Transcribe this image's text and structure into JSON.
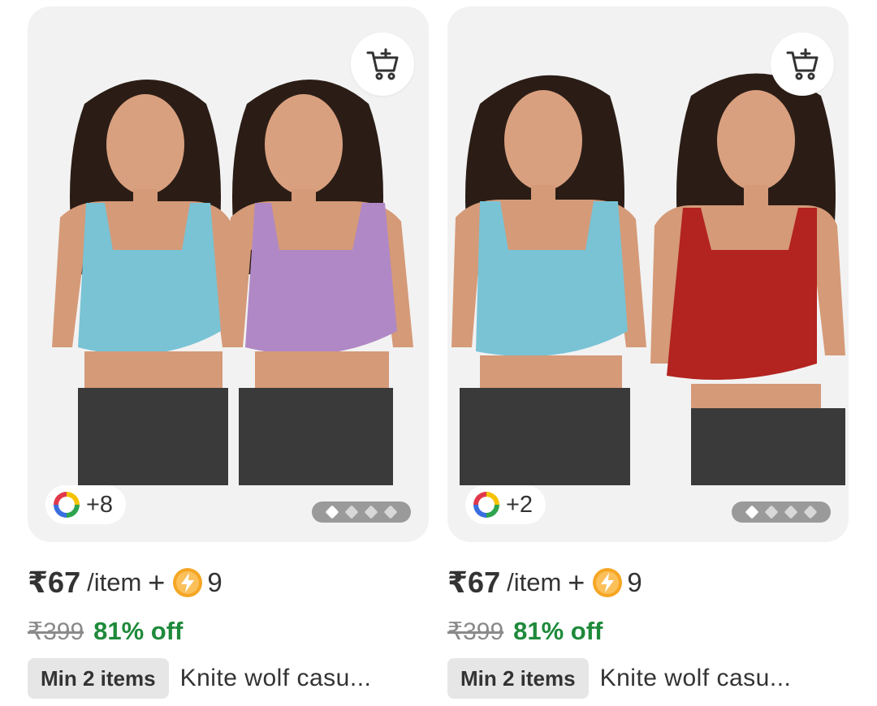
{
  "products": [
    {
      "color_count": "+8",
      "price": "₹67",
      "per_unit": "/item",
      "plus": "+",
      "coins": "9",
      "mrp": "₹399",
      "discount": "81% off",
      "min_badge": "Min 2 items",
      "title": "Knite wolf casu...",
      "carousel_active_index": 0,
      "carousel_total": 4,
      "top_colors": [
        "#79c3d5",
        "#b088c5"
      ]
    },
    {
      "color_count": "+2",
      "price": "₹67",
      "per_unit": "/item",
      "plus": "+",
      "coins": "9",
      "mrp": "₹399",
      "discount": "81% off",
      "min_badge": "Min 2 items",
      "title": "Knite wolf casu...",
      "carousel_active_index": 0,
      "carousel_total": 4,
      "top_colors": [
        "#79c3d5",
        "#b3231f"
      ]
    }
  ],
  "colors": {
    "discount": "#1f8a3b",
    "coin": "#f5a623",
    "card_bg": "#f2f2f2"
  },
  "icons": {
    "cart": "cart-plus-icon",
    "palette": "color-wheel-icon",
    "coin": "lightning-coin-icon"
  }
}
